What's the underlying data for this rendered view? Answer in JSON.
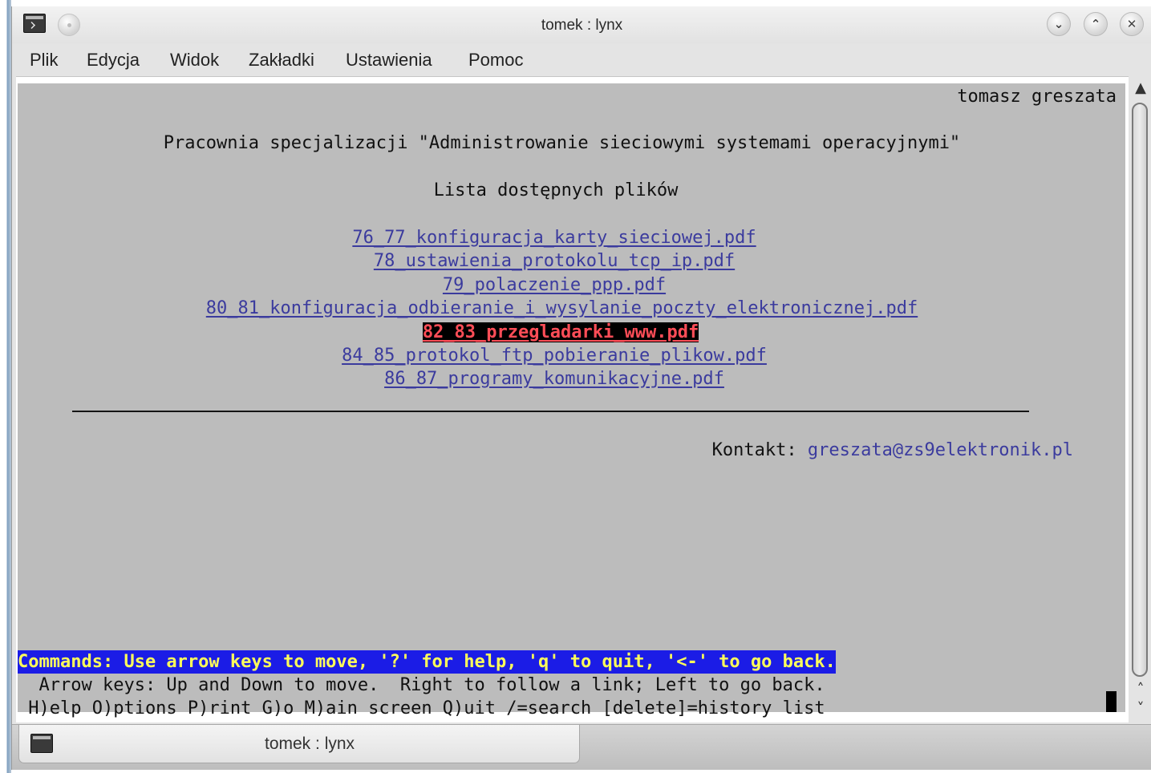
{
  "window": {
    "title": "tomek : lynx"
  },
  "menu": [
    "Plik",
    "Edycja",
    "Widok",
    "Zakładki",
    "Ustawienia",
    "Pomoc"
  ],
  "page": {
    "author": "tomasz greszata",
    "heading": "Pracownia specjalizacji \"Administrowanie sieciowymi systemami operacyjnymi\"",
    "subheading": "Lista dostępnych plików",
    "files": [
      "76_77_konfiguracja_karty_sieciowej.pdf",
      "78_ustawienia_protokolu_tcp_ip.pdf",
      "79_polaczenie_ppp.pdf",
      "80_81_konfiguracja_odbieranie_i_wysylanie_poczty_elektronicznej.pdf",
      "82_83_przegladarki_www.pdf",
      "84_85_protokol_ftp_pobieranie_plikow.pdf",
      "86_87_programy_komunikacyjne.pdf"
    ],
    "contact_label": "Kontakt: ",
    "contact_email": "greszata@zs9elektronik.pl"
  },
  "status": {
    "commands": "Commands: Use arrow keys to move, '?' for help, 'q' to quit, '<-' to go back.",
    "arrow_help": "  Arrow keys: Up and Down to move.  Right to follow a link; Left to go back.",
    "shortcuts": " H)elp O)ptions P)rint G)o M)ain screen Q)uit /=search [delete]=history list"
  },
  "scrollbar": {
    "up_icon": "▲",
    "down_icons": [
      "˄",
      "˅"
    ]
  },
  "taskbar": {
    "label": "tomek : lynx"
  },
  "colors": {
    "terminal_bg": "#bcbcbc",
    "link": "#3b3b9e",
    "selected_link": "#ff4d57",
    "command_bar_bg": "#1b1ce6",
    "command_bar_text": "#ffff5a"
  }
}
